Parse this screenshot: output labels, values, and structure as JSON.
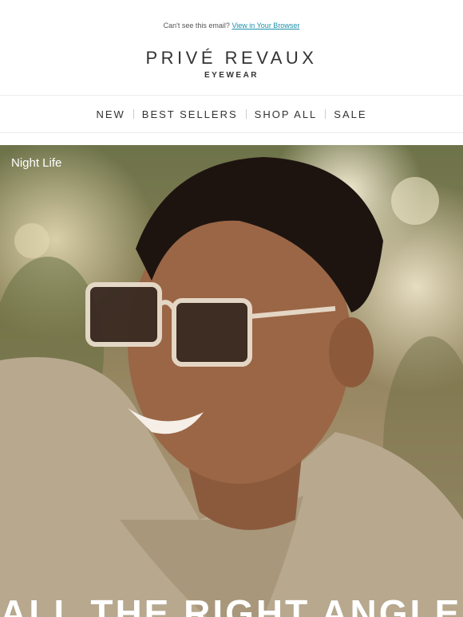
{
  "preheader": {
    "text": "Can't see this email?",
    "link": "View in Your Browser"
  },
  "brand": {
    "name": "PRIVÉ REVAUX",
    "tagline": "EYEWEAR"
  },
  "nav": {
    "items": [
      "NEW",
      "BEST SELLERS",
      "SHOP ALL",
      "SALE"
    ]
  },
  "hero": {
    "label": "Night Life",
    "headline": "ALL THE RIGHT ANGLES",
    "image_alt": "smiling man wearing clear-frame sunglasses"
  },
  "colors": {
    "link": "#1a8fa8",
    "text": "#333333",
    "rule": "#ececec"
  }
}
